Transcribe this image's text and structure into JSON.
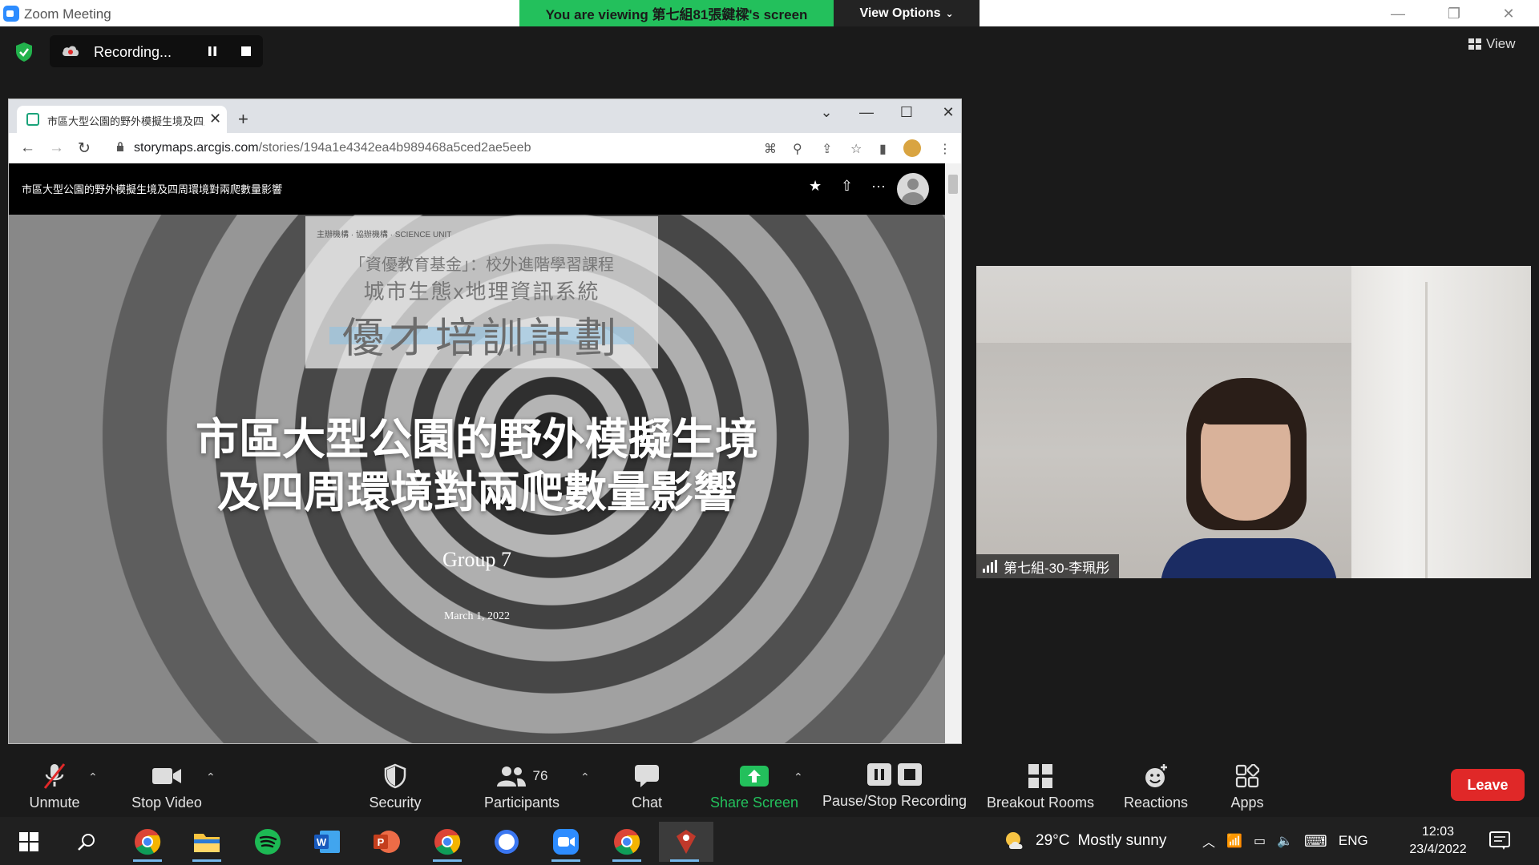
{
  "window": {
    "title": "Zoom Meeting",
    "viewing_banner": "You are viewing 第七組81張鍵樑's screen",
    "view_options_label": "View Options",
    "view_label": "View"
  },
  "recording": {
    "label": "Recording..."
  },
  "browser": {
    "tab_title": "市區大型公園的野外模擬生境及四周環境對兩爬數量影響",
    "url_domain": "storymaps.arcgis.com",
    "url_path": "/stories/194a1e4342ea4b989468a5ced2ae5eeb"
  },
  "storymap": {
    "header_title": "市區大型公園的野外模擬生境及四周環境對兩爬數量影響",
    "banner_logos": "主辦機構 · 協辦機構 · SCIENCE UNIT",
    "banner_line1": "「資優教育基金」：校外進階學習課程",
    "banner_line2": "城市生態x地理資訊系統",
    "banner_line3": "優才培訓計劃",
    "cover_title_line1": "市區大型公園的野外模擬生境",
    "cover_title_line2": "及四周環境對兩爬數量影響",
    "group": "Group 7",
    "date": "March 1, 2022"
  },
  "participant": {
    "name": "第七組-30-李珮彤"
  },
  "controls": {
    "unmute": "Unmute",
    "stop_video": "Stop Video",
    "security": "Security",
    "participants": "Participants",
    "participants_count": "76",
    "chat": "Chat",
    "share_screen": "Share Screen",
    "pause_stop_recording": "Pause/Stop Recording",
    "breakout_rooms": "Breakout Rooms",
    "reactions": "Reactions",
    "apps": "Apps",
    "leave": "Leave"
  },
  "taskbar": {
    "temperature": "29°C",
    "weather": "Mostly sunny",
    "language": "ENG",
    "time": "12:03",
    "date": "23/4/2022"
  },
  "colors": {
    "zoom_blue": "#2d8cff",
    "banner_green": "#23c05c",
    "share_green": "#23c05c",
    "leave_red": "#e02828"
  }
}
